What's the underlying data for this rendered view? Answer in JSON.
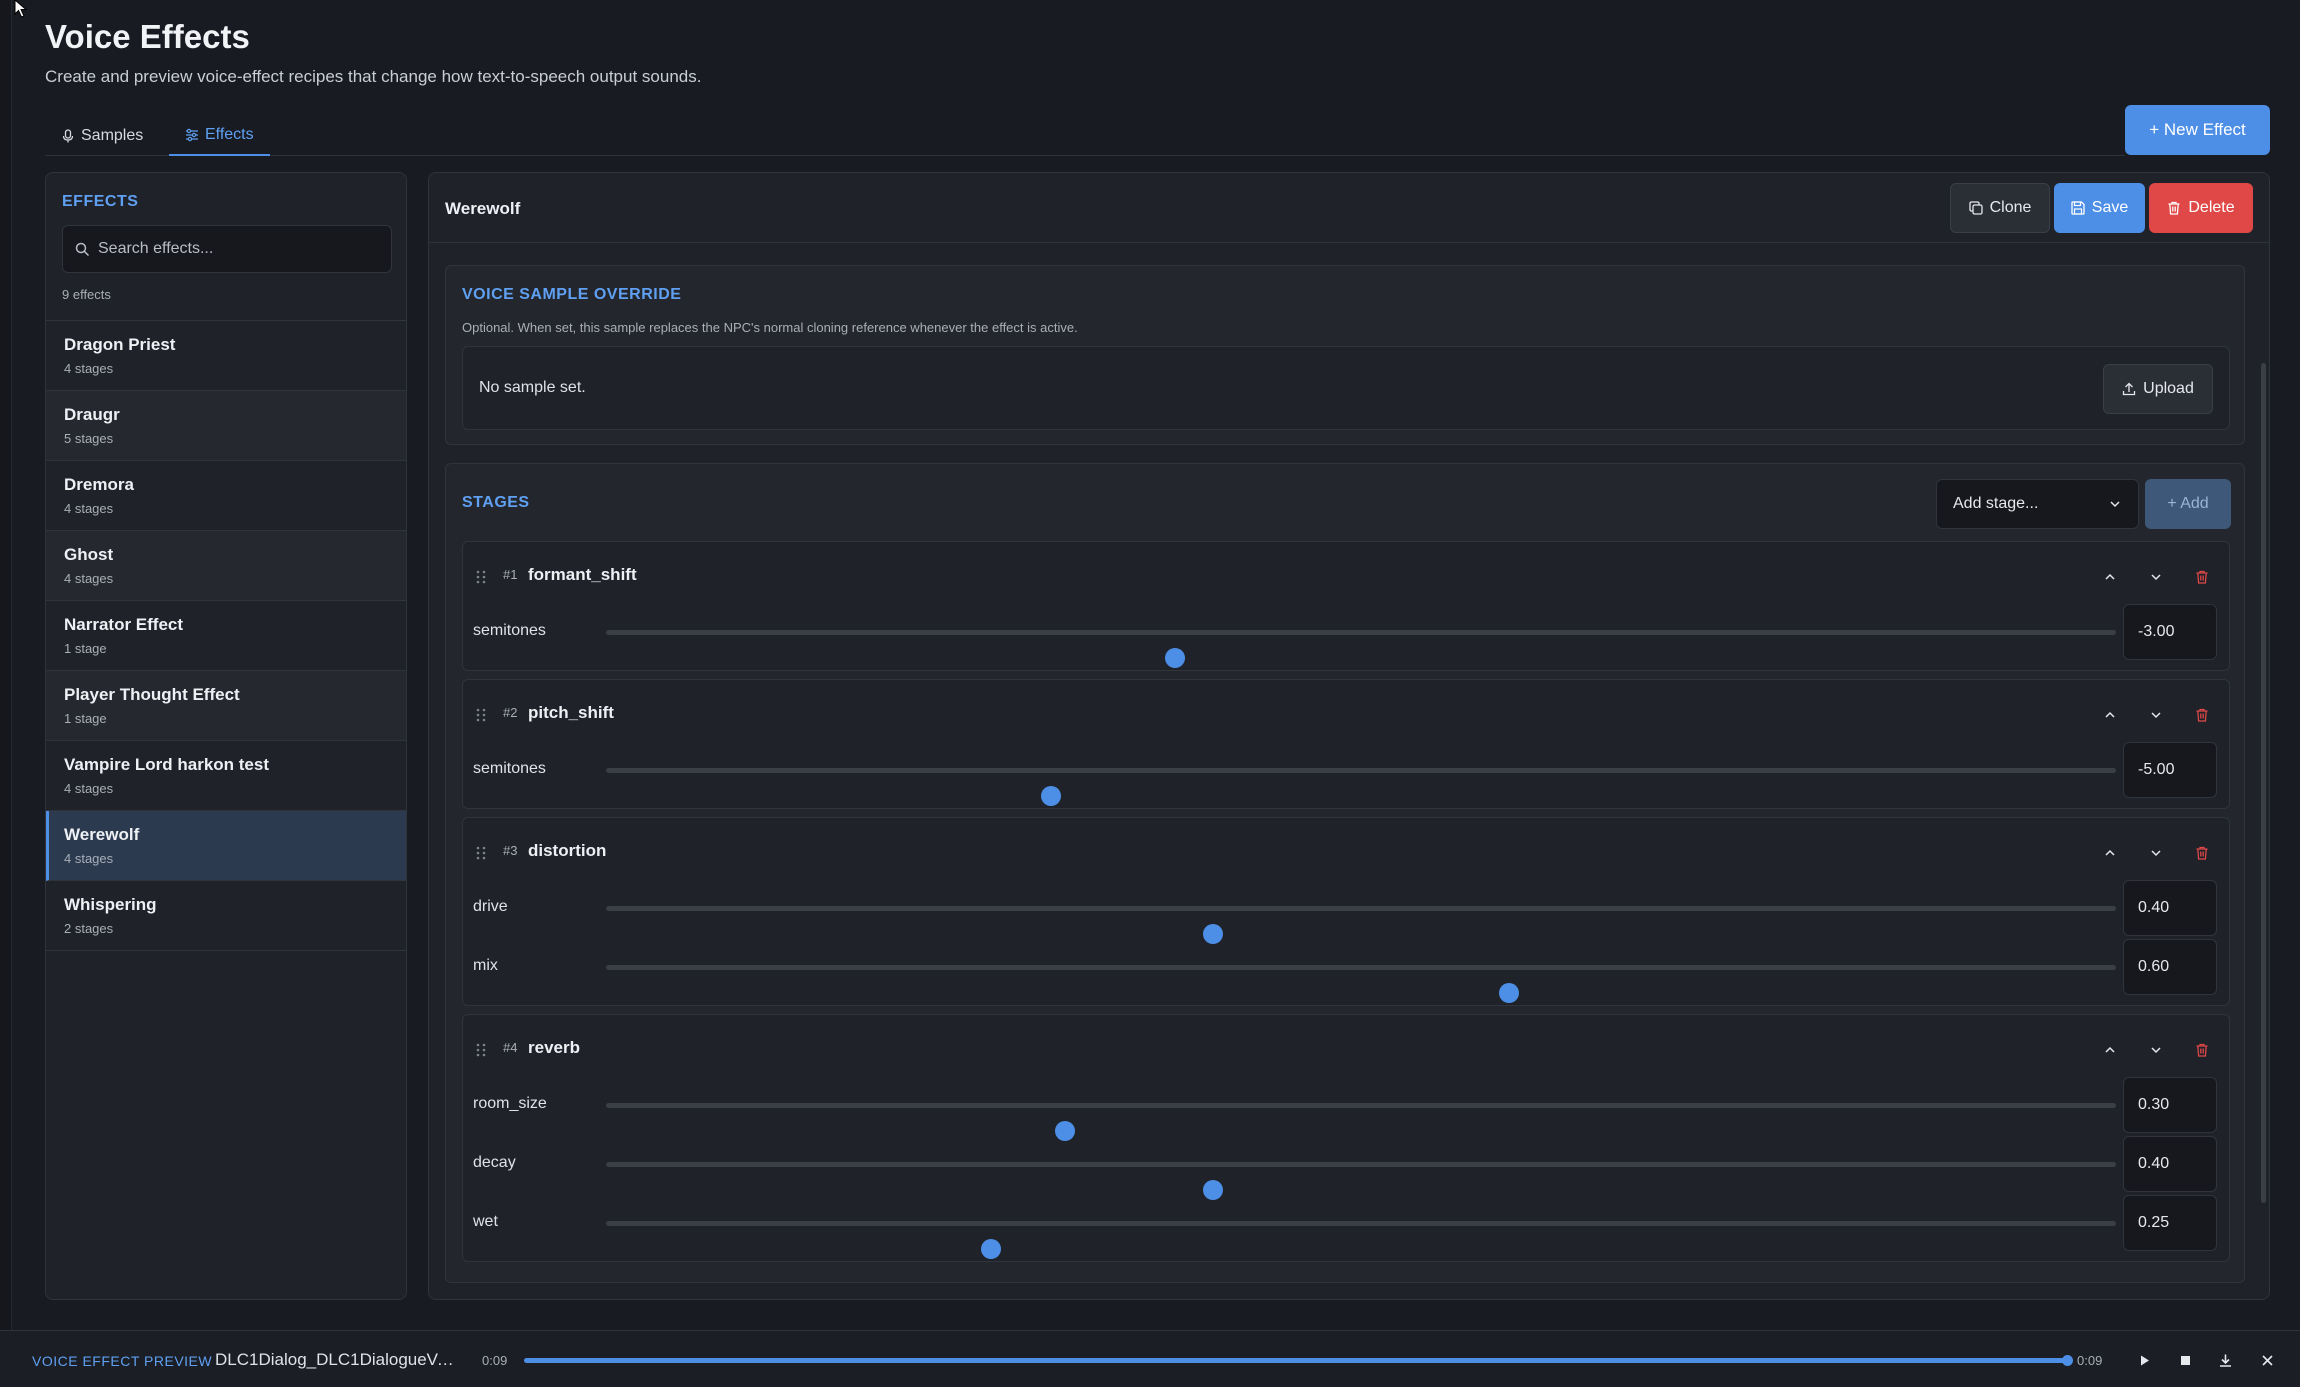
{
  "page": {
    "title": "Voice Effects",
    "subtitle": "Create and preview voice-effect recipes that change how text-to-speech output sounds."
  },
  "tabs": [
    {
      "label": "Samples",
      "icon": "microphone-icon",
      "active": false
    },
    {
      "label": "Effects",
      "icon": "sliders-icon",
      "active": true
    }
  ],
  "new_effect_button": "+ New Effect",
  "sidebar": {
    "heading": "EFFECTS",
    "search_placeholder": "Search effects...",
    "count": "9 effects",
    "items": [
      {
        "name": "Dragon Priest",
        "stages": "4 stages"
      },
      {
        "name": "Draugr",
        "stages": "5 stages"
      },
      {
        "name": "Dremora",
        "stages": "4 stages"
      },
      {
        "name": "Ghost",
        "stages": "4 stages"
      },
      {
        "name": "Narrator Effect",
        "stages": "1 stage"
      },
      {
        "name": "Player Thought Effect",
        "stages": "1 stage"
      },
      {
        "name": "Vampire Lord harkon test",
        "stages": "4 stages"
      },
      {
        "name": "Werewolf",
        "stages": "4 stages",
        "active": true
      },
      {
        "name": "Whispering",
        "stages": "2 stages"
      }
    ]
  },
  "editor": {
    "title": "Werewolf",
    "clone_label": "Clone",
    "save_label": "Save",
    "delete_label": "Delete",
    "override": {
      "heading": "VOICE SAMPLE OVERRIDE",
      "description": "Optional. When set, this sample replaces the NPC's normal cloning reference whenever the effect is active.",
      "empty_text": "No sample set.",
      "upload_label": "Upload"
    },
    "stages_heading": "STAGES",
    "add_stage_select": "Add stage...",
    "add_button": "+ Add",
    "stages": [
      {
        "num": "#1",
        "name": "formant_shift",
        "params": [
          {
            "label": "semitones",
            "value": "-3.00",
            "fraction": 0.377
          }
        ]
      },
      {
        "num": "#2",
        "name": "pitch_shift",
        "params": [
          {
            "label": "semitones",
            "value": "-5.00",
            "fraction": 0.295
          }
        ]
      },
      {
        "num": "#3",
        "name": "distortion",
        "params": [
          {
            "label": "drive",
            "value": "0.40",
            "fraction": 0.402
          },
          {
            "label": "mix",
            "value": "0.60",
            "fraction": 0.598
          }
        ]
      },
      {
        "num": "#4",
        "name": "reverb",
        "params": [
          {
            "label": "room_size",
            "value": "0.30",
            "fraction": 0.304
          },
          {
            "label": "decay",
            "value": "0.40",
            "fraction": 0.402
          },
          {
            "label": "wet",
            "value": "0.25",
            "fraction": 0.255
          }
        ]
      }
    ]
  },
  "player": {
    "label": "VOICE EFFECT PREVIEW",
    "file": "DLC1Dialog_DLC1DialogueVa...",
    "time_start": "0:09",
    "time_end": "0:09",
    "progress": 1.0
  },
  "colors": {
    "accent": "#4d8fe6",
    "danger": "#e04848",
    "background": "#181b21"
  }
}
